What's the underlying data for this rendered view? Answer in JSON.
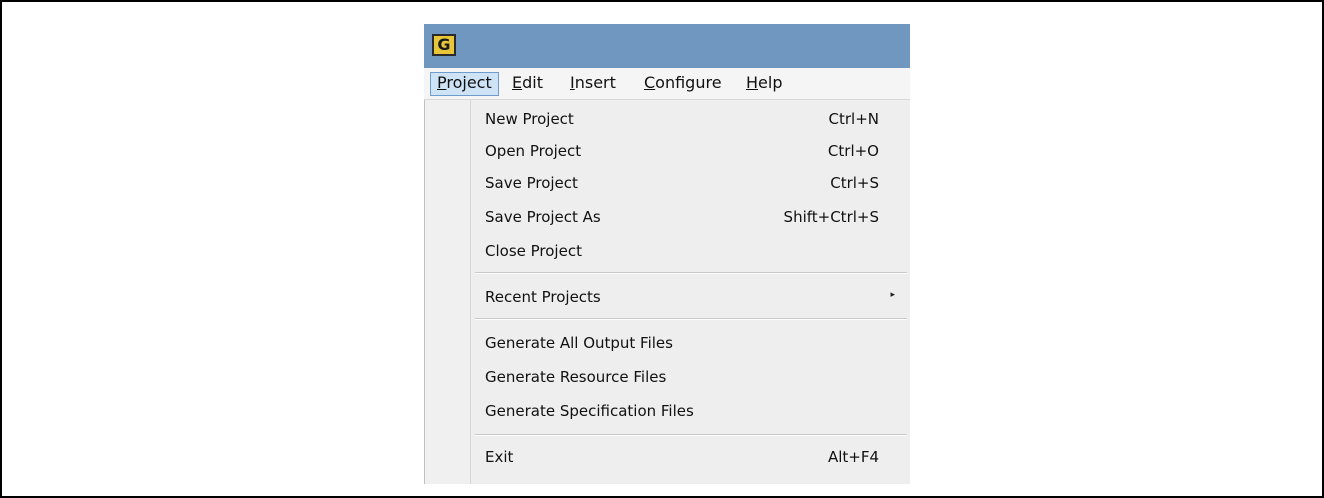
{
  "window": {
    "icon": "app-logo-icon",
    "icon_glyph": "G"
  },
  "menubar": {
    "items": [
      {
        "label": "Project",
        "mnemonic": "P",
        "active": true
      },
      {
        "label": "Edit",
        "mnemonic": "E"
      },
      {
        "label": "Insert",
        "mnemonic": "I"
      },
      {
        "label": "Configure",
        "mnemonic": "C"
      },
      {
        "label": "Help",
        "mnemonic": "H"
      }
    ]
  },
  "menu": {
    "items": [
      {
        "label": "New Project",
        "shortcut": "Ctrl+N"
      },
      {
        "label": "Open Project",
        "shortcut": "Ctrl+O"
      },
      {
        "label": "Save Project",
        "shortcut": "Ctrl+S"
      },
      {
        "label": "Save Project As",
        "shortcut": "Shift+Ctrl+S"
      },
      {
        "label": "Close Project",
        "shortcut": ""
      },
      {
        "label": "Recent Projects",
        "submenu_arrow": "▸"
      },
      {
        "label": "Generate All Output Files",
        "shortcut": ""
      },
      {
        "label": "Generate Resource Files",
        "shortcut": ""
      },
      {
        "label": "Generate Specification Files",
        "shortcut": ""
      },
      {
        "label": "Exit",
        "shortcut": "Alt+F4"
      }
    ]
  },
  "colors": {
    "titlebar": "#6f97c0",
    "menu_highlight": "#cfe3f7",
    "menu_background": "#eeeeee"
  }
}
